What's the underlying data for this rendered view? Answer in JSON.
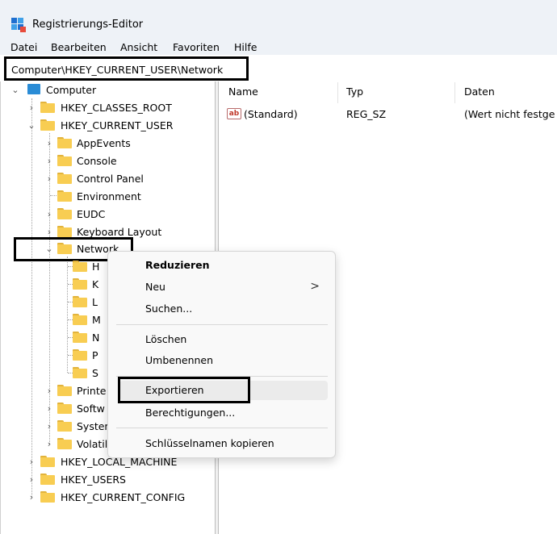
{
  "window": {
    "title": "Registrierungs-Editor",
    "icon": "registry-editor-icon"
  },
  "menu": [
    "Datei",
    "Bearbeiten",
    "Ansicht",
    "Favoriten",
    "Hilfe"
  ],
  "address": {
    "path": "Computer\\HKEY_CURRENT_USER\\Network"
  },
  "tree": {
    "root": "Computer",
    "hives": {
      "classes_root": "HKEY_CLASSES_ROOT",
      "current_user": "HKEY_CURRENT_USER",
      "local_machine": "HKEY_LOCAL_MACHINE",
      "users": "HKEY_USERS",
      "current_config": "HKEY_CURRENT_CONFIG"
    },
    "user_keys": [
      "AppEvents",
      "Console",
      "Control Panel",
      "Environment",
      "EUDC",
      "Keyboard Layout",
      "Network"
    ],
    "network_subkeys": [
      "H",
      "K",
      "L",
      "M",
      "N",
      "P",
      "S"
    ],
    "more_user_keys": [
      "Printe",
      "Softw",
      "Syster",
      "Volatil"
    ]
  },
  "values": {
    "columns": {
      "name": "Name",
      "type": "Typ",
      "data": "Daten"
    },
    "rows": [
      {
        "name": "(Standard)",
        "type": "REG_SZ",
        "data": "(Wert nicht festge"
      }
    ]
  },
  "context_menu": {
    "collapse": "Reduzieren",
    "new": "Neu",
    "find": "Suchen...",
    "delete": "Löschen",
    "rename": "Umbenennen",
    "export": "Exportieren",
    "permissions": "Berechtigungen...",
    "copy_key_name": "Schlüsselnamen kopieren",
    "submenu_arrow": ">"
  },
  "glyphs": {
    "expand": "›",
    "collapse": "⌄"
  },
  "colors": {
    "folder": "#f8cd52",
    "titlebar": "#eef2f7",
    "highlight_border": "#000000"
  }
}
